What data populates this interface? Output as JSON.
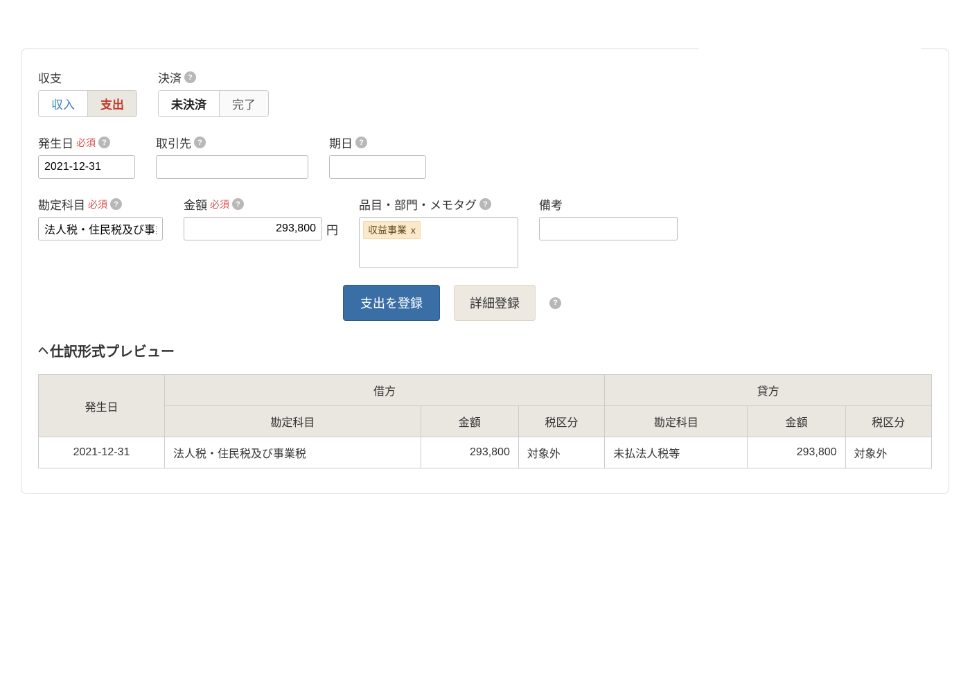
{
  "incomeExpense": {
    "label": "収支",
    "income": "収入",
    "expense": "支出"
  },
  "settlement": {
    "label": "決済",
    "pending": "未決済",
    "complete": "完了"
  },
  "required": "必須",
  "occurDate": {
    "label": "発生日",
    "value": "2021-12-31"
  },
  "partner": {
    "label": "取引先",
    "value": ""
  },
  "dueDate": {
    "label": "期日",
    "value": ""
  },
  "account": {
    "label": "勘定科目",
    "value": "法人税・住民税及び事業税"
  },
  "amount": {
    "label": "金額",
    "value": "293,800",
    "suffix": "円"
  },
  "tags": {
    "label": "品目・部門・メモタグ",
    "tag1": "収益事業",
    "tagX": "x"
  },
  "remarks": {
    "label": "備考",
    "value": ""
  },
  "buttons": {
    "register": "支出を登録",
    "detail": "詳細登録"
  },
  "preview": {
    "title": "仕訳形式プレビュー",
    "headers": {
      "date": "発生日",
      "debit": "借方",
      "credit": "貸方",
      "account": "勘定科目",
      "amount": "金額",
      "tax": "税区分"
    },
    "row": {
      "date": "2021-12-31",
      "debitAccount": "法人税・住民税及び事業税",
      "debitAmount": "293,800",
      "debitTax": "対象外",
      "creditAccount": "未払法人税等",
      "creditAmount": "293,800",
      "creditTax": "対象外"
    }
  }
}
